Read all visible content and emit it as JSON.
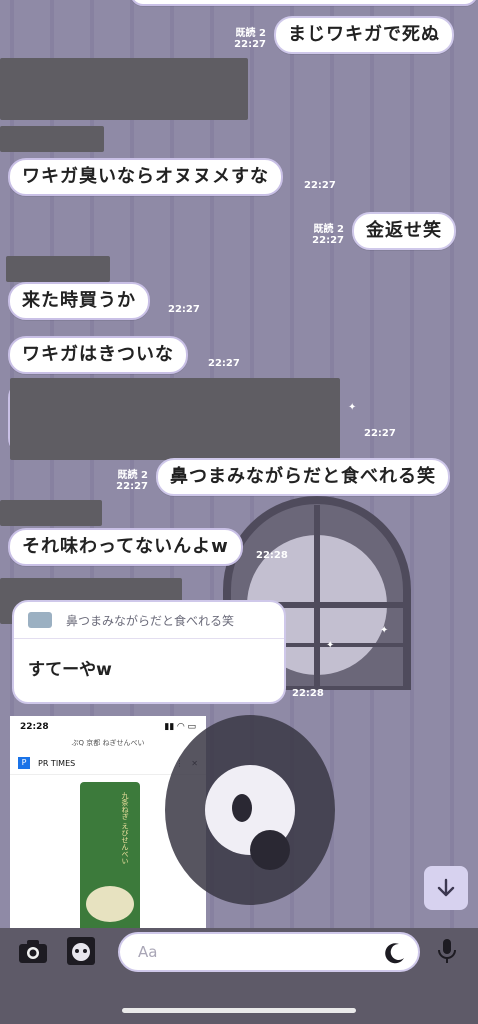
{
  "messages": [
    {
      "id": "m1",
      "side": "right",
      "text": "まじワキガで死ぬ",
      "read": "既読 2",
      "time": "22:27"
    },
    {
      "id": "m2",
      "side": "left",
      "text": "ワキガ臭いならオヌヌメすな",
      "time": "22:27"
    },
    {
      "id": "m3",
      "side": "right",
      "text": "金返せ笑",
      "read": "既読 2",
      "time": "22:27"
    },
    {
      "id": "m4",
      "side": "left",
      "text": "来た時買うか",
      "time": "22:27"
    },
    {
      "id": "m5",
      "side": "left",
      "text": "ワキガはきついな",
      "time": "22:27"
    },
    {
      "id": "m6",
      "side": "left",
      "time": "22:27"
    },
    {
      "id": "m7",
      "side": "right",
      "text": "鼻つまみながらだと食べれる笑",
      "read": "既読 2",
      "time": "22:27"
    },
    {
      "id": "m8",
      "side": "left",
      "text": "それ味わってないんよw",
      "time": "22:28"
    },
    {
      "id": "m9",
      "side": "left",
      "quote": "鼻つまみながらだと食べれる笑",
      "text": "すてーやw",
      "time": "22:28"
    }
  ],
  "screenshot_preview": {
    "status_time": "22:28",
    "url": "ぷQ 京都 ねぎせんべい",
    "site": "PR TIMES",
    "product_label": "九条ねぎ えびせんべい"
  },
  "composer": {
    "placeholder": "Aa",
    "icons": [
      "camera-icon",
      "sticker-photo-icon",
      "moon-icon",
      "microphone-icon"
    ]
  },
  "scroll_down_icon": "arrow-down-icon"
}
